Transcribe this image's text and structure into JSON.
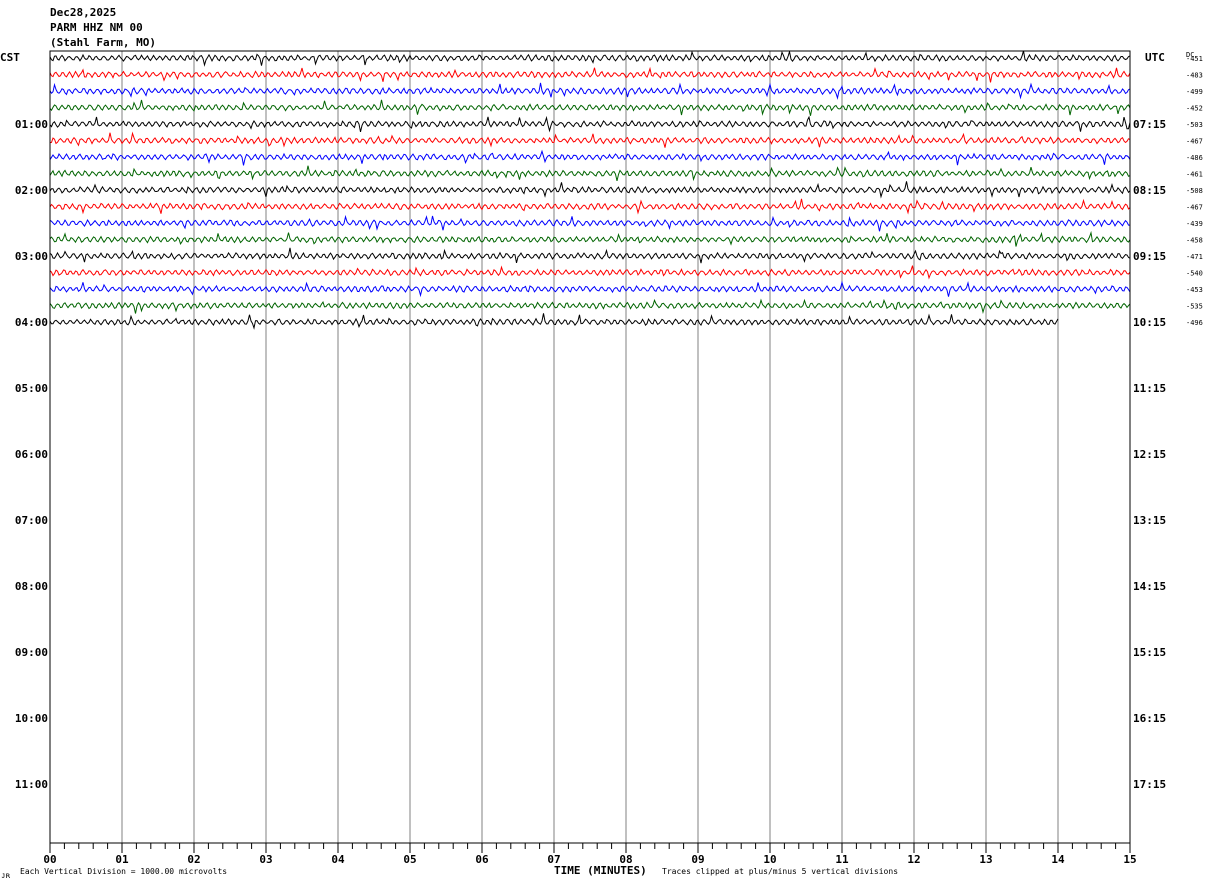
{
  "header": {
    "date": "Dec28,2025",
    "station": "PARM HHZ NM 00",
    "location": "(Stahl Farm, MO)"
  },
  "labels": {
    "cst": "CST",
    "utc": "UTC",
    "dc": "DC",
    "x_axis_title": "TIME (MINUTES)",
    "footer_left": "Each Vertical Division = 1000.00 microvolts",
    "footer_right": "Traces clipped at plus/minus 5 vertical divisions",
    "corner_mark": "ᴊʀ"
  },
  "colors": {
    "trace_cycle": [
      "#000000",
      "#ff0000",
      "#0000ff",
      "#006400"
    ],
    "gridline": "#808080",
    "frame": "#000000"
  },
  "chart_data": {
    "type": "line",
    "title": "PARM HHZ NM 00 (Stahl Farm, MO)",
    "xlabel": "TIME (MINUTES)",
    "xlim": [
      0,
      15
    ],
    "x_ticks": [
      "00",
      "01",
      "02",
      "03",
      "04",
      "05",
      "06",
      "07",
      "08",
      "09",
      "10",
      "11",
      "12",
      "13",
      "14",
      "15"
    ],
    "x_minor_step": 0.2,
    "left_axis_cst": [
      "01:00",
      "02:00",
      "03:00",
      "04:00",
      "05:00",
      "06:00",
      "07:00",
      "08:00",
      "09:00",
      "10:00",
      "11:00"
    ],
    "right_axis_utc": [
      "07:15",
      "08:15",
      "09:15",
      "10:15",
      "11:15",
      "12:15",
      "13:15",
      "14:15",
      "15:15",
      "16:15",
      "17:15"
    ],
    "rows_per_hour": 4,
    "total_rows": 48,
    "vertical_division_microvolts": 1000.0,
    "clip_divisions": 5,
    "grid": true,
    "traces": [
      {
        "row": 0,
        "dc": "-451",
        "end_minute": 15
      },
      {
        "row": 1,
        "dc": "-483",
        "end_minute": 15
      },
      {
        "row": 2,
        "dc": "-499",
        "end_minute": 15
      },
      {
        "row": 3,
        "dc": "-452",
        "end_minute": 15
      },
      {
        "row": 4,
        "dc": "-503",
        "end_minute": 15
      },
      {
        "row": 5,
        "dc": "-467",
        "end_minute": 15
      },
      {
        "row": 6,
        "dc": "-486",
        "end_minute": 15
      },
      {
        "row": 7,
        "dc": "-461",
        "end_minute": 15
      },
      {
        "row": 8,
        "dc": "-508",
        "end_minute": 15
      },
      {
        "row": 9,
        "dc": "-467",
        "end_minute": 15
      },
      {
        "row": 10,
        "dc": "-439",
        "end_minute": 15
      },
      {
        "row": 11,
        "dc": "-458",
        "end_minute": 15
      },
      {
        "row": 12,
        "dc": "-471",
        "end_minute": 15
      },
      {
        "row": 13,
        "dc": "-540",
        "end_minute": 15
      },
      {
        "row": 14,
        "dc": "-453",
        "end_minute": 15
      },
      {
        "row": 15,
        "dc": "-535",
        "end_minute": 15
      },
      {
        "row": 16,
        "dc": "-496",
        "end_minute": 14
      }
    ]
  }
}
